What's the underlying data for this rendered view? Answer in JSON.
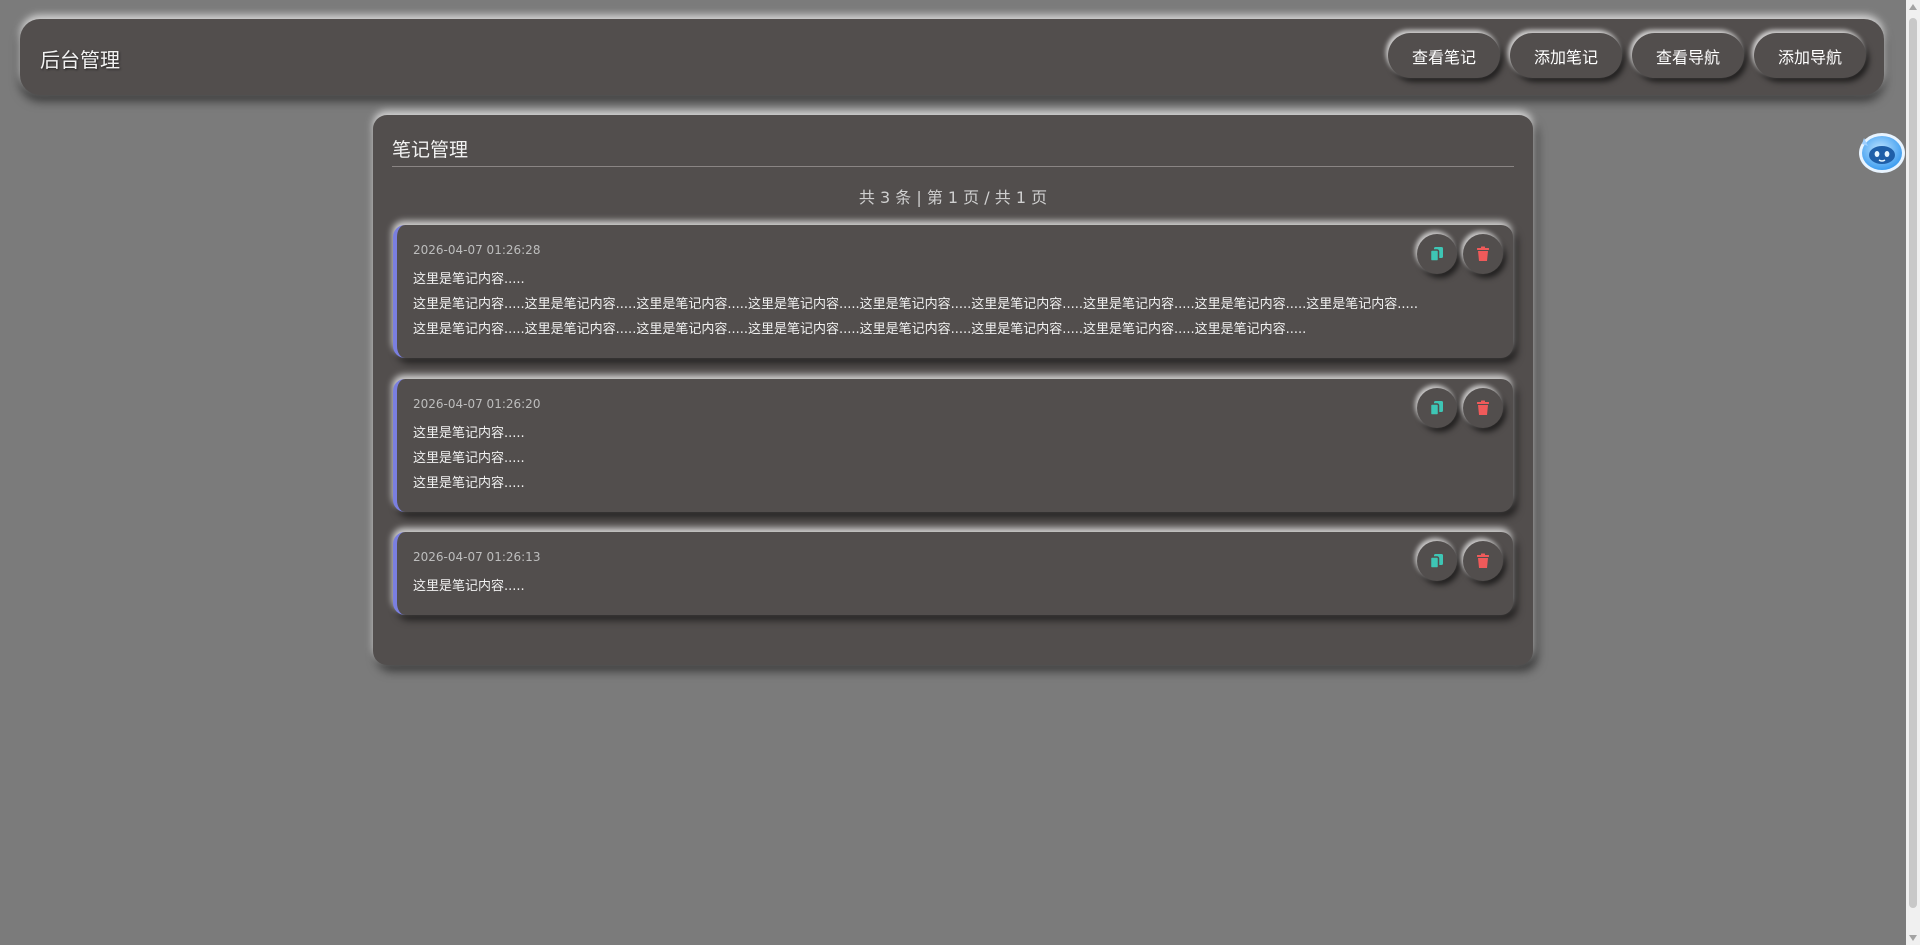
{
  "header": {
    "title": "后台管理",
    "nav": [
      {
        "label": "查看笔记"
      },
      {
        "label": "添加笔记"
      },
      {
        "label": "查看导航"
      },
      {
        "label": "添加导航"
      }
    ]
  },
  "panel": {
    "title": "笔记管理",
    "pagination": "共 3 条 | 第 1 页 / 共 1 页"
  },
  "notes": [
    {
      "time": "2026-04-07 01:26:28",
      "lines": [
        "这里是笔记内容.....",
        "这里是笔记内容.....这里是笔记内容.....这里是笔记内容.....这里是笔记内容.....这里是笔记内容.....这里是笔记内容.....这里是笔记内容.....这里是笔记内容.....这里是笔记内容.....这里是笔记内容.....这里是笔记内容.....这里是笔记内容.....这里是笔记内容.....这里是笔记内容.....这里是笔记内容.....这里是笔记内容.....这里是笔记内容....."
      ]
    },
    {
      "time": "2026-04-07 01:26:20",
      "lines": [
        "这里是笔记内容.....",
        "这里是笔记内容.....",
        "这里是笔记内容....."
      ]
    },
    {
      "time": "2026-04-07 01:26:13",
      "lines": [
        "这里是笔记内容....."
      ]
    }
  ],
  "colors": {
    "background": "#7b7b7b",
    "surface": "#524e4d",
    "note_accent": "#7a7fe0",
    "copy_icon": "#3ec6b5",
    "delete_icon": "#f05a5a"
  },
  "icons": {
    "copy": "copy-icon",
    "delete": "trash-icon",
    "mascot": "robot-mascot-icon"
  }
}
